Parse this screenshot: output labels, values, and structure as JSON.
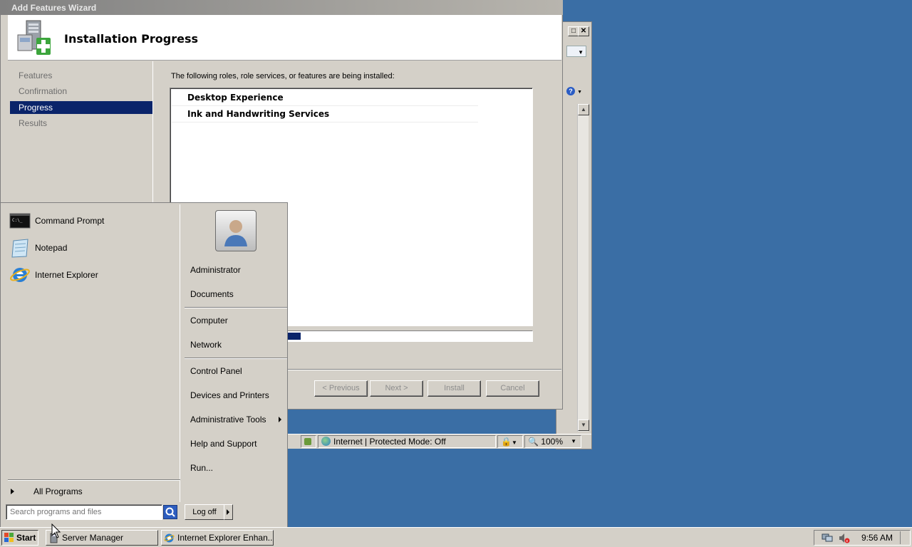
{
  "wizard": {
    "title": "Add Features Wizard",
    "header_title": "Installation Progress",
    "nav": [
      "Features",
      "Confirmation",
      "Progress",
      "Results"
    ],
    "active_nav": "Progress",
    "description": "The following roles, role services, or features are being installed:",
    "items": [
      "Desktop Experience",
      "Ink and Handwriting Services"
    ],
    "progress": 0.36,
    "buttons": {
      "previous": "< Previous",
      "next": "Next >",
      "install": "Install",
      "cancel": "Cancel"
    }
  },
  "ie": {
    "status_zone": "Internet | Protected Mode: Off",
    "zoom": "100%"
  },
  "start_menu": {
    "pinned": [
      "Command Prompt",
      "Notepad",
      "Internet Explorer"
    ],
    "all_programs": "All Programs",
    "search_placeholder": "Search programs and files",
    "right_items": {
      "user": "Administrator",
      "documents": "Documents",
      "computer": "Computer",
      "network": "Network",
      "control_panel": "Control Panel",
      "devices": "Devices and Printers",
      "admin_tools": "Administrative Tools",
      "help": "Help and Support",
      "run": "Run..."
    },
    "log_off": "Log off"
  },
  "taskbar": {
    "start": "Start",
    "tasks": [
      "Server Manager",
      "Internet Explorer Enhan..."
    ],
    "clock": "9:56 AM"
  },
  "colors": {
    "desktop": "#3a6ea5",
    "selection": "#0a246a",
    "chrome": "#d4d0c8"
  }
}
